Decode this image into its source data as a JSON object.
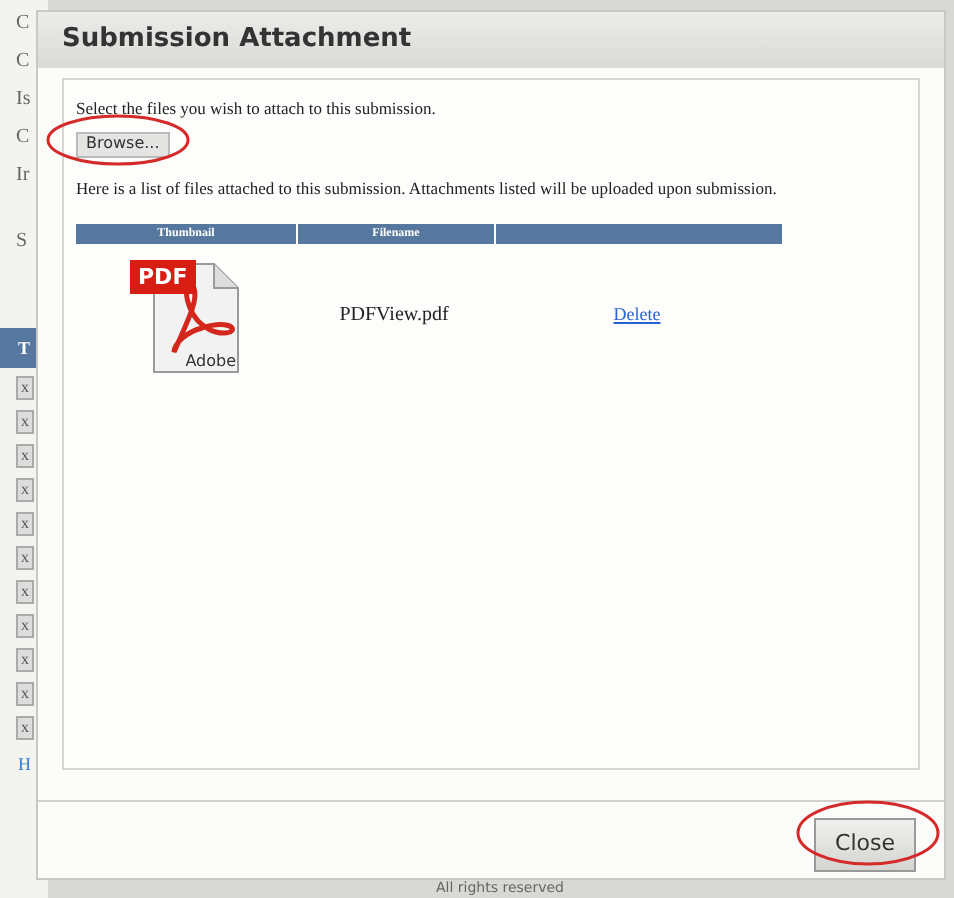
{
  "background_page": {
    "labels": [
      "C",
      "C",
      "Is",
      "C",
      "Ir",
      "S"
    ],
    "table_header": "T",
    "remove_markers": [
      "x",
      "x",
      "x",
      "x",
      "x",
      "x",
      "x",
      "x",
      "x",
      "x",
      "x"
    ],
    "link": "H",
    "footer": "All rights reserved"
  },
  "dialog": {
    "title": "Submission Attachment",
    "instruction": "Select the files you wish to attach to this submission.",
    "browse_button": "Browse...",
    "list_intro": "Here is a list of files attached to this submission. Attachments listed will be uploaded upon submission.",
    "table": {
      "columns": [
        "Thumbnail",
        "Filename"
      ],
      "rows": [
        {
          "thumbnail": {
            "badge": "PDF",
            "caption": "Adobe"
          },
          "filename": "PDFView.pdf",
          "action": "Delete"
        }
      ]
    },
    "close_button": "Close"
  }
}
